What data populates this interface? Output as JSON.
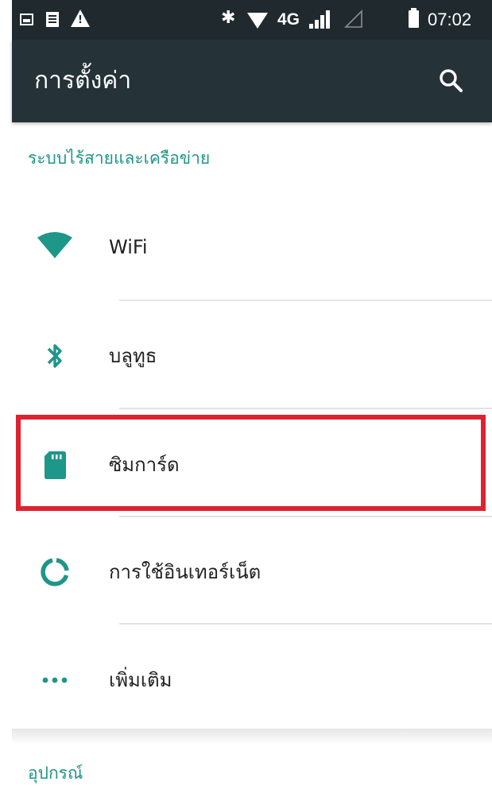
{
  "status_bar": {
    "network_type": "4G",
    "time": "07:02",
    "icons": [
      "image-icon",
      "document-icon",
      "warning-icon",
      "bluetooth-icon",
      "wifi-icon",
      "signal-icon",
      "signal-empty-icon",
      "battery-icon"
    ]
  },
  "app_bar": {
    "title": "การตั้งค่า",
    "search_icon": "search-icon"
  },
  "sections": [
    {
      "header": "ระบบไร้สายและเครือข่าย",
      "items": [
        {
          "label": "WiFi",
          "icon": "wifi-icon"
        },
        {
          "label": "บลูทูธ",
          "icon": "bluetooth-icon"
        },
        {
          "label": "ซิมการ์ด",
          "icon": "sim-card-icon",
          "highlighted": true
        },
        {
          "label": "การใช้อินเทอร์เน็ต",
          "icon": "data-usage-icon"
        },
        {
          "label": "เพิ่มเติม",
          "icon": "more-icon"
        }
      ]
    },
    {
      "header": "อุปกรณ์",
      "items": []
    }
  ],
  "colors": {
    "status_bar": "#20292e",
    "app_bar": "#253238",
    "accent": "#1e9688",
    "highlight": "#e0212e",
    "text_primary": "#212121"
  }
}
